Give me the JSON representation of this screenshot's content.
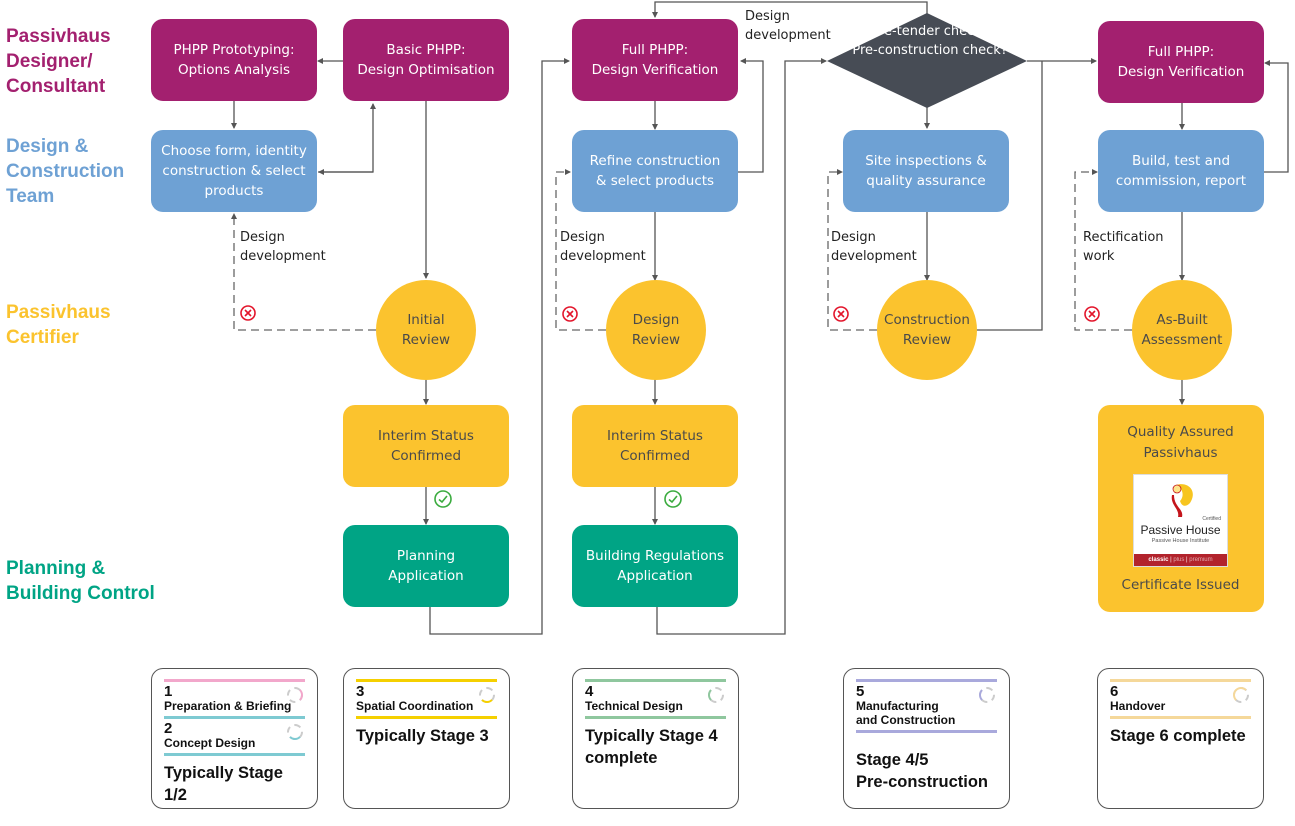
{
  "lanes": [
    {
      "id": "designer",
      "label": "Passivhaus\nDesigner/\nConsultant",
      "color": "#a3206f"
    },
    {
      "id": "team",
      "label": "Design &\nConstruction\nTeam",
      "color": "#6ea1d4"
    },
    {
      "id": "certifier",
      "label": "Passivhaus\nCertifier",
      "color": "#fbc32e"
    },
    {
      "id": "planning",
      "label": "Planning &\nBuilding Control",
      "color": "#00a485"
    }
  ],
  "nodes": {
    "phpp_prototyping": "PHPP Prototyping:\nOptions Analysis",
    "basic_phpp": "Basic PHPP:\nDesign Optimisation",
    "choose_form": "Choose form, identity\nconstruction & select\nproducts",
    "initial_review": "Initial\nReview",
    "interim_status_1": "Interim Status\nConfirmed",
    "planning_application": "Planning\nApplication",
    "full_phpp_1": "Full PHPP:\nDesign Verification",
    "refine_construction": "Refine construction\n& select products",
    "design_review": "Design\nReview",
    "interim_status_2": "Interim Status\nConfirmed",
    "building_regs": "Building Regulations\nApplication",
    "decision": "Pre-tender check?\nPre-construction check?",
    "site_inspections": "Site inspections &\nquality assurance",
    "construction_review": "Construction\nReview",
    "full_phpp_2": "Full PHPP:\nDesign Verification",
    "build_test": "Build, test and\ncommission, report",
    "as_built": "As-Built\nAssessment",
    "quality_assured": "Quality Assured\nPassivhaus",
    "certificate_issued": "Certificate Issued"
  },
  "notes": {
    "design_dev_1": "Design\ndevelopment",
    "design_dev_2": "Design\ndevelopment",
    "design_dev_top": "Design\ndevelopment",
    "design_dev_3": "Design\ndevelopment",
    "rectification": "Rectification\nwork"
  },
  "certificate_logo": {
    "certified": "Certified",
    "title": "Passive House",
    "subtitle": "Passive House Institute",
    "classes": [
      "classic",
      "plus",
      "premium"
    ],
    "selected_class": "classic"
  },
  "stages": [
    {
      "entries": [
        {
          "number": "1",
          "name": "Preparation & Briefing",
          "color": "#f2a7cb"
        },
        {
          "number": "2",
          "name": "Concept Design",
          "color": "#7ecad2"
        }
      ],
      "summary": "Typically Stage 1/2"
    },
    {
      "entries": [
        {
          "number": "3",
          "name": "Spatial Coordination",
          "color": "#f5d000"
        }
      ],
      "summary": "Typically Stage 3"
    },
    {
      "entries": [
        {
          "number": "4",
          "name": "Technical Design",
          "color": "#8fc79e"
        }
      ],
      "summary": "Typically Stage 4\ncomplete"
    },
    {
      "entries": [
        {
          "number": "5",
          "name": "Manufacturing\nand Construction",
          "color": "#a9a9dc"
        }
      ],
      "summary": "Stage 4/5\nPre-construction"
    },
    {
      "entries": [
        {
          "number": "6",
          "name": "Handover",
          "color": "#f5d89a"
        }
      ],
      "summary": "Stage 6 complete"
    }
  ],
  "icons": {
    "reject": "x-circle-icon",
    "approve": "check-circle-icon"
  },
  "colors": {
    "reject": "#e3152b",
    "approve": "#3aab3e",
    "connector": "#555555",
    "decision": "#474c55"
  }
}
